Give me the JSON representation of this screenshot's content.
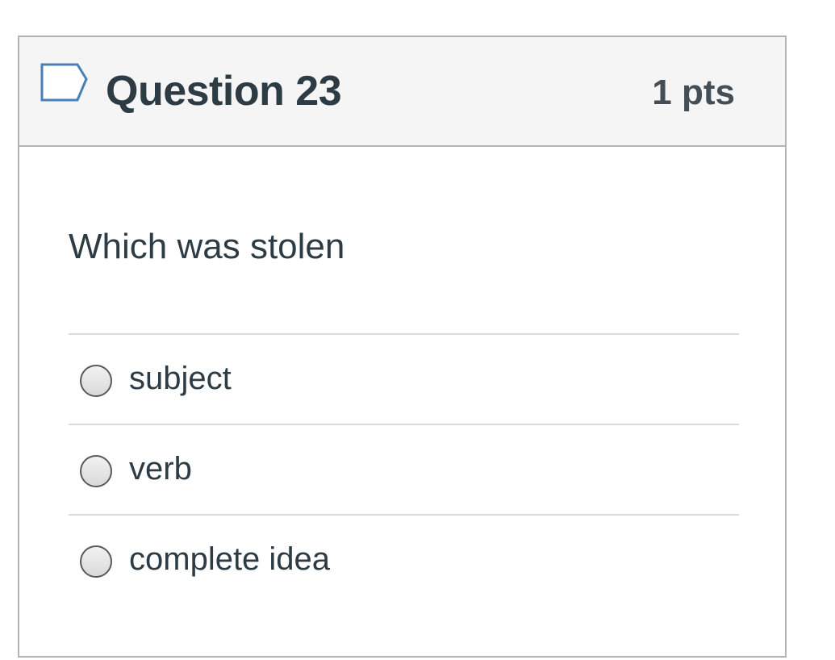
{
  "question": {
    "title": "Question 23",
    "points": "1 pts",
    "flag_icon": "flag-outline-icon",
    "text": "Which was stolen"
  },
  "answers": [
    {
      "label": "subject",
      "selected": false
    },
    {
      "label": "verb",
      "selected": false
    },
    {
      "label": "complete idea",
      "selected": false
    }
  ],
  "colors": {
    "header_background": "#f5f5f5",
    "border": "#b3b3b3",
    "divider": "#dcdcdc",
    "text": "#2d3b45",
    "flag_stroke": "#4a7fb5"
  }
}
